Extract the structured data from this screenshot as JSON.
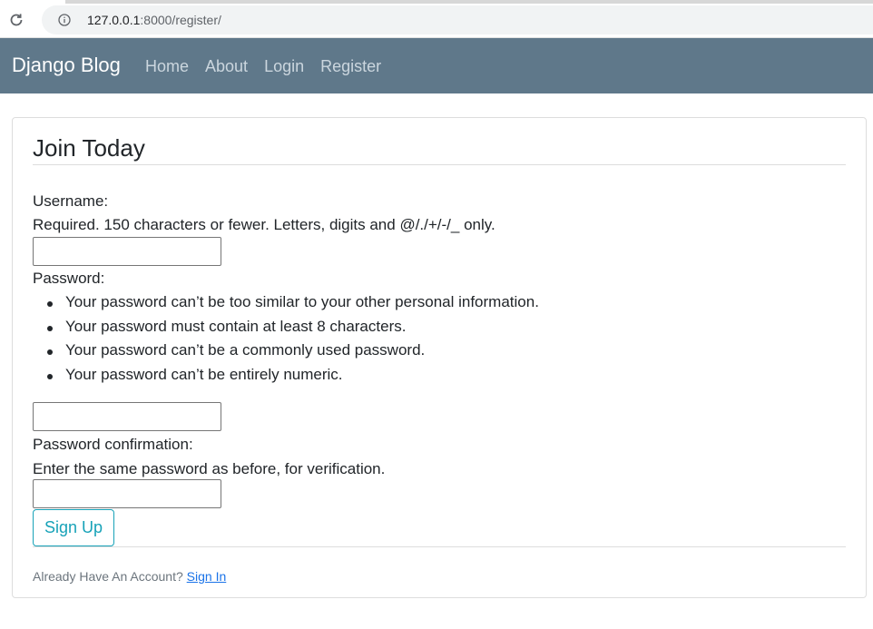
{
  "browser": {
    "url_host": "127.0.0.1",
    "url_rest": ":8000/register/",
    "reload_icon": "reload-icon",
    "info_icon": "info-icon"
  },
  "navbar": {
    "brand": "Django Blog",
    "links": [
      "Home",
      "About",
      "Login",
      "Register"
    ],
    "background": "#5f788a"
  },
  "form": {
    "legend": "Join Today",
    "username_label": "Username:",
    "username_help": "Required. 150 characters or fewer. Letters, digits and @/./+/-/_ only.",
    "username_value": "",
    "password_label": "Password:",
    "password_rules": [
      "Your password can’t be too similar to your other personal information.",
      "Your password must contain at least 8 characters.",
      "Your password can’t be a commonly used password.",
      "Your password can’t be entirely numeric."
    ],
    "password_value": "",
    "confirm_label": "Password confirmation:",
    "confirm_help": "Enter the same password as before, for verification.",
    "confirm_value": "",
    "submit_label": "Sign Up",
    "accent": "#17a2b8"
  },
  "footer": {
    "prompt": "Already Have An Account?",
    "link": "Sign In"
  }
}
